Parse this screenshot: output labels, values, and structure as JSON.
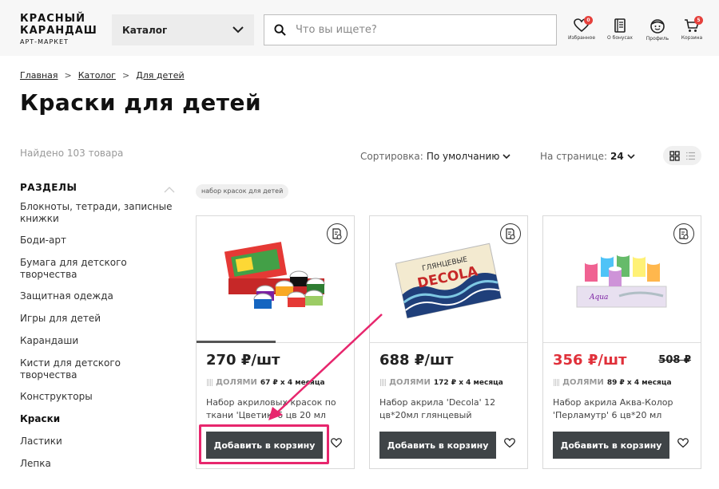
{
  "header": {
    "logo_line1": "КРАСНЫЙ",
    "logo_line2": "КАРАНДАШ",
    "logo_line3": "АРТ-МАРКЕТ",
    "catalog_label": "Каталог",
    "search_placeholder": "Что вы ищете?",
    "icons": [
      {
        "label": "Избранное",
        "badge": "0",
        "icon": "heart-icon"
      },
      {
        "label": "О бонусах",
        "badge": "",
        "icon": "book-icon"
      },
      {
        "label": "Профиль",
        "badge": "",
        "icon": "profile-icon"
      },
      {
        "label": "Корзина",
        "badge": "5",
        "icon": "cart-icon"
      }
    ]
  },
  "breadcrumb": {
    "items": [
      "Главная",
      "Катoлог",
      "Для детей"
    ],
    "separator": ">"
  },
  "page_title": "Краски для детей",
  "found_text": "Найдено 103 товара",
  "sort": {
    "label": "Сортировка:",
    "value": "По умолчанию"
  },
  "per_page": {
    "label": "На странице:",
    "value": "24"
  },
  "sidebar": {
    "title": "РАЗДЕЛЫ",
    "items": [
      {
        "label": "Блокноты, тетради, записные книжки",
        "active": false
      },
      {
        "label": "Боди-арт",
        "active": false
      },
      {
        "label": "Бумага для детского творчества",
        "active": false
      },
      {
        "label": "Защитная одежда",
        "active": false
      },
      {
        "label": "Игры для детей",
        "active": false
      },
      {
        "label": "Карандаши",
        "active": false
      },
      {
        "label": "Кисти для детского творчества",
        "active": false
      },
      {
        "label": "Конструкторы",
        "active": false
      },
      {
        "label": "Краски",
        "active": true
      },
      {
        "label": "Ластики",
        "active": false
      },
      {
        "label": "Лепка",
        "active": false
      }
    ]
  },
  "tag": "набор красок для детей",
  "products": [
    {
      "price": "270 ₽/шт",
      "old_price": "",
      "dolyami_label": "ДОЛЯМИ",
      "installment": "67 ₽ х 4 месяца",
      "name": "Набор акриловых красок по ткани 'Цветик' 6 цв 20 мл",
      "add_label": "Добавить в корзину",
      "price_color": "#222222"
    },
    {
      "price": "688 ₽/шт",
      "old_price": "",
      "dolyami_label": "ДОЛЯМИ",
      "installment": "172 ₽ х 4 месяца",
      "name": "Набор акрила 'Decola' 12 цв*20мл глянцевый",
      "add_label": "Добавить в корзину",
      "price_color": "#222222"
    },
    {
      "price": "356 ₽/шт",
      "old_price": "508 ₽",
      "dolyami_label": "ДОЛЯМИ",
      "installment": "89 ₽ х 4 месяца",
      "name": "Набор акрила Аква-Колор 'Перламутр' 6 цв*20 мл",
      "add_label": "Добавить в корзину",
      "price_color": "#e0303a"
    }
  ],
  "product_images": {
    "decola_header": "ГЛЯНЦЕВЫЕ",
    "decola_brand": "DECOLA",
    "aqua_brand": "Aqua"
  },
  "colors": {
    "accent_highlight": "#e7266d",
    "button_bg": "#3f4447",
    "badge": "#e5413c",
    "sale_price": "#e0303a"
  }
}
